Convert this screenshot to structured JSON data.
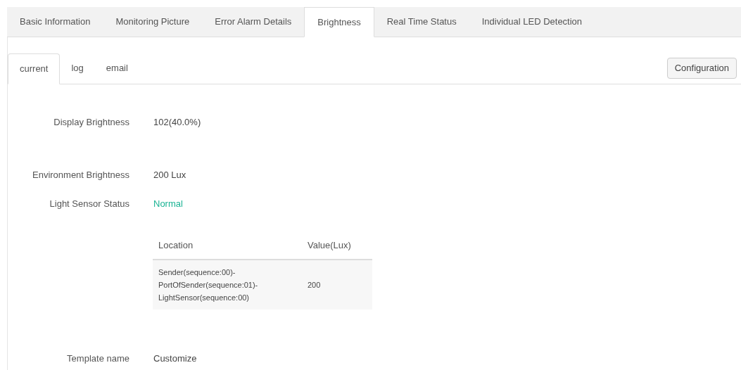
{
  "tabs": [
    {
      "label": "Basic Information",
      "selected": false
    },
    {
      "label": "Monitoring Picture",
      "selected": false
    },
    {
      "label": "Error Alarm Details",
      "selected": false
    },
    {
      "label": "Brightness",
      "selected": true
    },
    {
      "label": "Real Time Status",
      "selected": false
    },
    {
      "label": "Individual LED Detection",
      "selected": false
    }
  ],
  "subtabs": [
    {
      "label": "current",
      "selected": true
    },
    {
      "label": "log",
      "selected": false
    },
    {
      "label": "email",
      "selected": false
    }
  ],
  "configuration_button": "Configuration",
  "fields": [
    {
      "label": "Display Brightness",
      "value": "102(40.0%)",
      "kind": "plain"
    },
    {
      "label": "Environment Brightness",
      "value": "200 Lux",
      "kind": "plain"
    },
    {
      "label": "Light Sensor Status",
      "value": "Normal",
      "kind": "status"
    }
  ],
  "sensor_table": {
    "columns": [
      "Location",
      "Value(Lux)"
    ],
    "rows": [
      [
        "Sender(sequence:00)-PortOfSender(sequence:01)-LightSensor(sequence:00)",
        "200"
      ]
    ]
  },
  "template": {
    "label": "Template name",
    "value": "Customize"
  }
}
